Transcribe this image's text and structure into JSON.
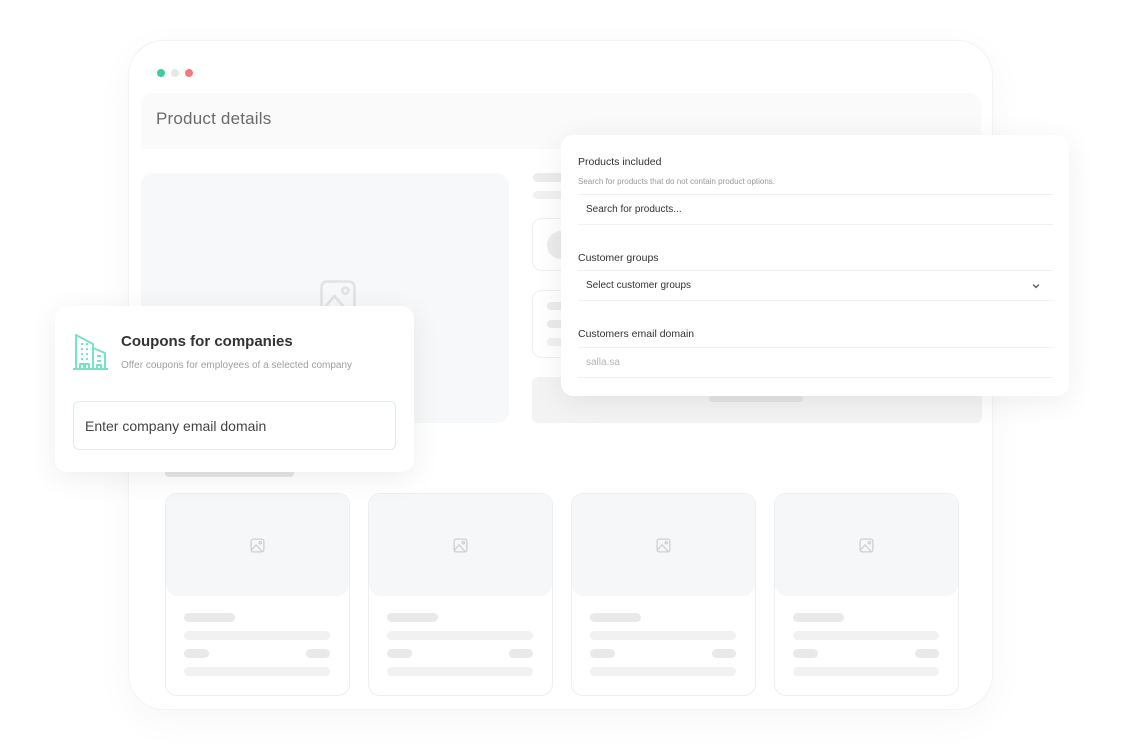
{
  "window": {
    "traffic_lights": [
      {
        "name": "green",
        "color": "#3dcd9a"
      },
      {
        "name": "gray",
        "color": "#e6e6e6"
      },
      {
        "name": "red",
        "color": "#f47a7a"
      }
    ],
    "title": "Product details"
  },
  "products_panel": {
    "products_included": {
      "label": "Products included",
      "hint": "Search for products that do not contain product options.",
      "placeholder": "Search for products..."
    },
    "customer_groups": {
      "label": "Customer groups",
      "value": "Select customer groups",
      "icon": "chevron-down-icon"
    },
    "email_domain": {
      "label": "Customers email domain",
      "placeholder": "salla.sa"
    }
  },
  "coupon_card": {
    "icon": "building-icon",
    "accent": "#76e3c6",
    "title": "Coupons for companies",
    "subtitle": "Offer coupons for employees of a selected company",
    "input_placeholder": "Enter company email domain"
  },
  "product_cards": [
    {
      "icon": "image-placeholder-icon"
    },
    {
      "icon": "image-placeholder-icon"
    },
    {
      "icon": "image-placeholder-icon"
    },
    {
      "icon": "image-placeholder-icon"
    }
  ]
}
